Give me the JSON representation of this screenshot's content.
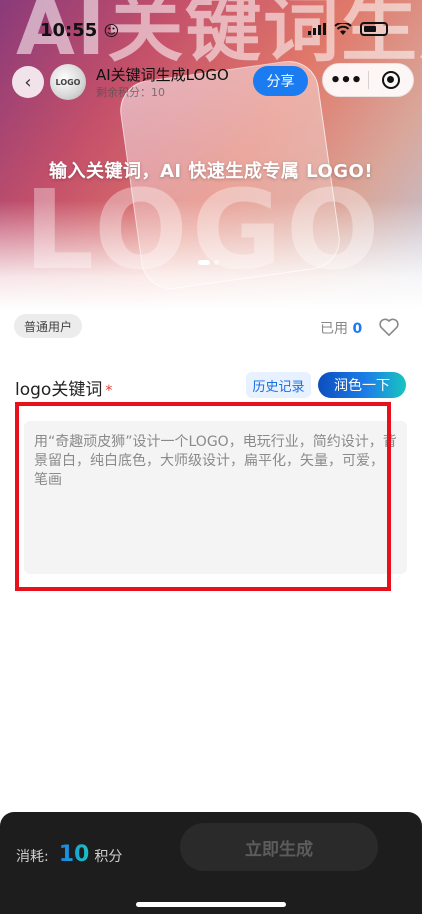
{
  "status_bar": {
    "time": "10:55",
    "time_icon": "smiley-icon",
    "icons": [
      "cellular-icon",
      "wifi-icon",
      "battery-icon"
    ]
  },
  "header": {
    "back_icon": "chevron-left-icon",
    "avatar_text": "LOGO",
    "title": "AI关键词生成LOGO",
    "subtitle": "剩余积分：10",
    "share_label": "分享",
    "more_icon": "more-dots-icon",
    "close_icon": "target-close-icon"
  },
  "hero": {
    "big_text": "AI关键词生成",
    "logo_text": "LOGO",
    "slogan": "输入关键词，AI 快速生成专属 LOGO!",
    "carousel_total": 2,
    "carousel_active": 0
  },
  "user": {
    "badge": "普通用户",
    "used_label": "已用",
    "used_count": "0",
    "favorite_icon": "heart-icon"
  },
  "keyword": {
    "label": "logo关键词",
    "required_mark": "*",
    "history_label": "历史记录",
    "polish_label": "润色一下",
    "placeholder": "用“奇趣顽皮狮”设计一个LOGO，电玩行业，简约设计，背景留白，纯白底色，大师级设计，扁平化，矢量，可爱，笔画"
  },
  "footer": {
    "cost_label": "消耗:",
    "cost_value": "10",
    "cost_unit": "积分",
    "generate_label": "立即生成"
  },
  "colors": {
    "accent_blue": "#1a7cf0",
    "highlight_red": "#e8101b",
    "bottom_bar": "#1d1d1d"
  }
}
